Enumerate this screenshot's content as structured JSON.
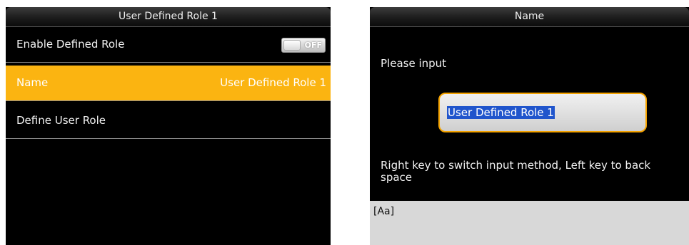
{
  "left": {
    "title": "User Defined Role 1",
    "rows": [
      {
        "label": "Enable Defined Role",
        "toggle": "OFF"
      },
      {
        "label": "Name",
        "value": "User Defined Role 1"
      },
      {
        "label": "Define User Role"
      }
    ]
  },
  "right": {
    "title": "Name",
    "prompt": "Please input",
    "input_value": "User Defined Role 1",
    "hint": "Right key to switch input method, Left key to back space",
    "ime_indicator": "[Aa]"
  },
  "colors": {
    "highlight": "#fbb411",
    "input_border": "#f5a300",
    "selection": "#2055cc"
  }
}
